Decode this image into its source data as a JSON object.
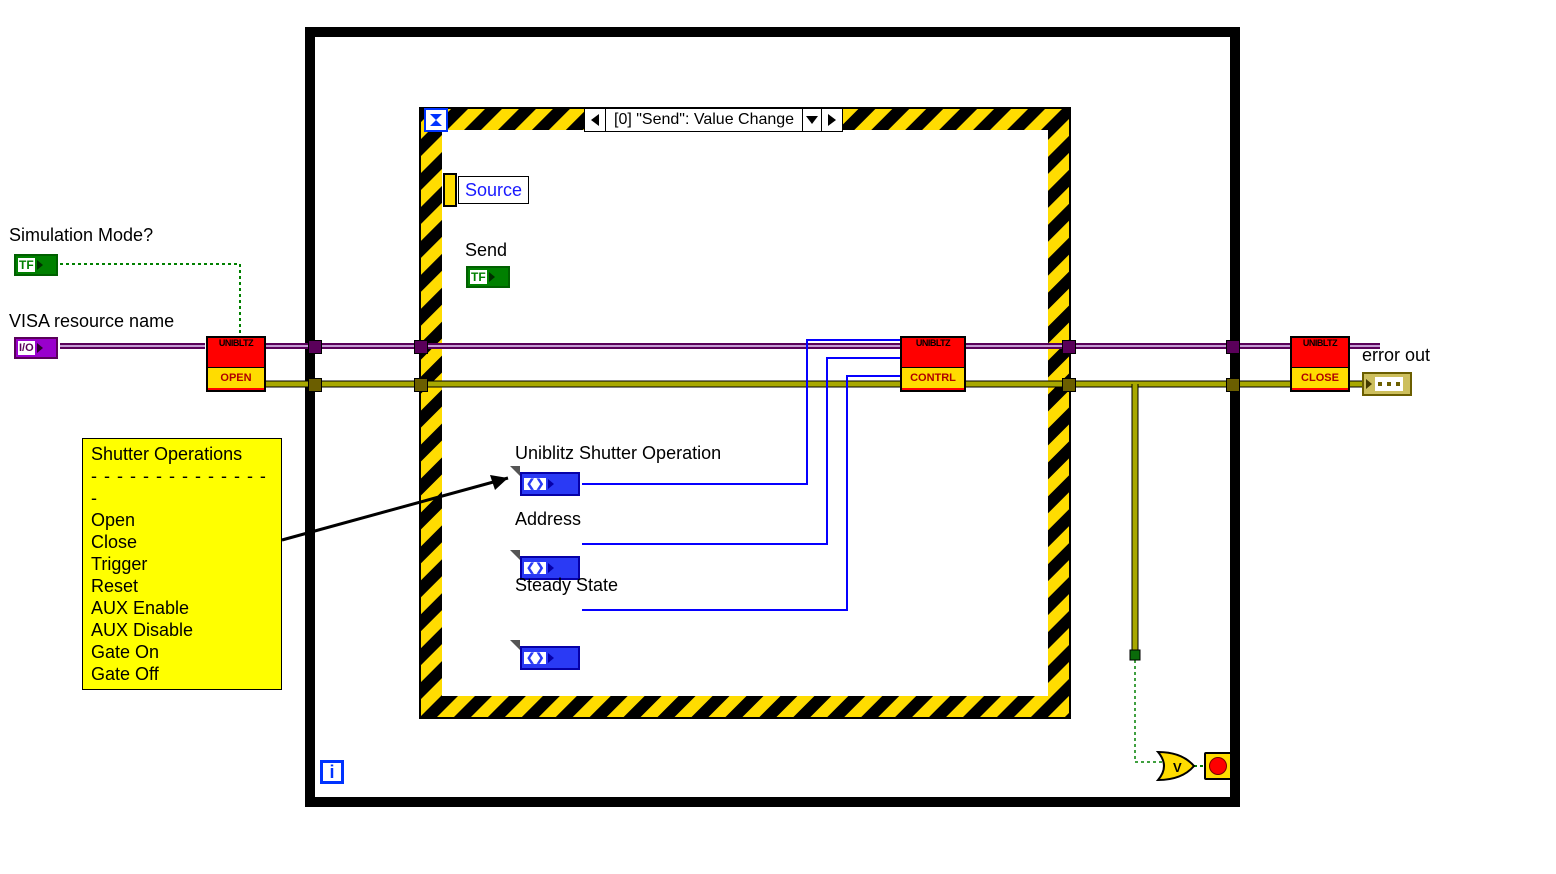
{
  "labels": {
    "sim_mode": "Simulation Mode?",
    "visa": "VISA resource name",
    "error_out": "error out",
    "send": "Send",
    "shutter_op": "Uniblitz Shutter Operation",
    "address": "Address",
    "steady_state": "Steady State",
    "source": "Source",
    "event_case": "[0] \"Send\": Value Change",
    "note_title": "Shutter Operations",
    "tf_glyph": "TF",
    "io_glyph": "I/O",
    "ring_glyph": "❮❯",
    "i_glyph": "i"
  },
  "note_items": [
    "Open",
    "Close",
    "Trigger",
    "Reset",
    "AUX Enable",
    "AUX Disable",
    "Gate On",
    "Gate Off"
  ],
  "subvi": {
    "brand": "UNIBLTZ",
    "open": "OPEN",
    "control": "CONTRL",
    "close": "CLOSE"
  }
}
